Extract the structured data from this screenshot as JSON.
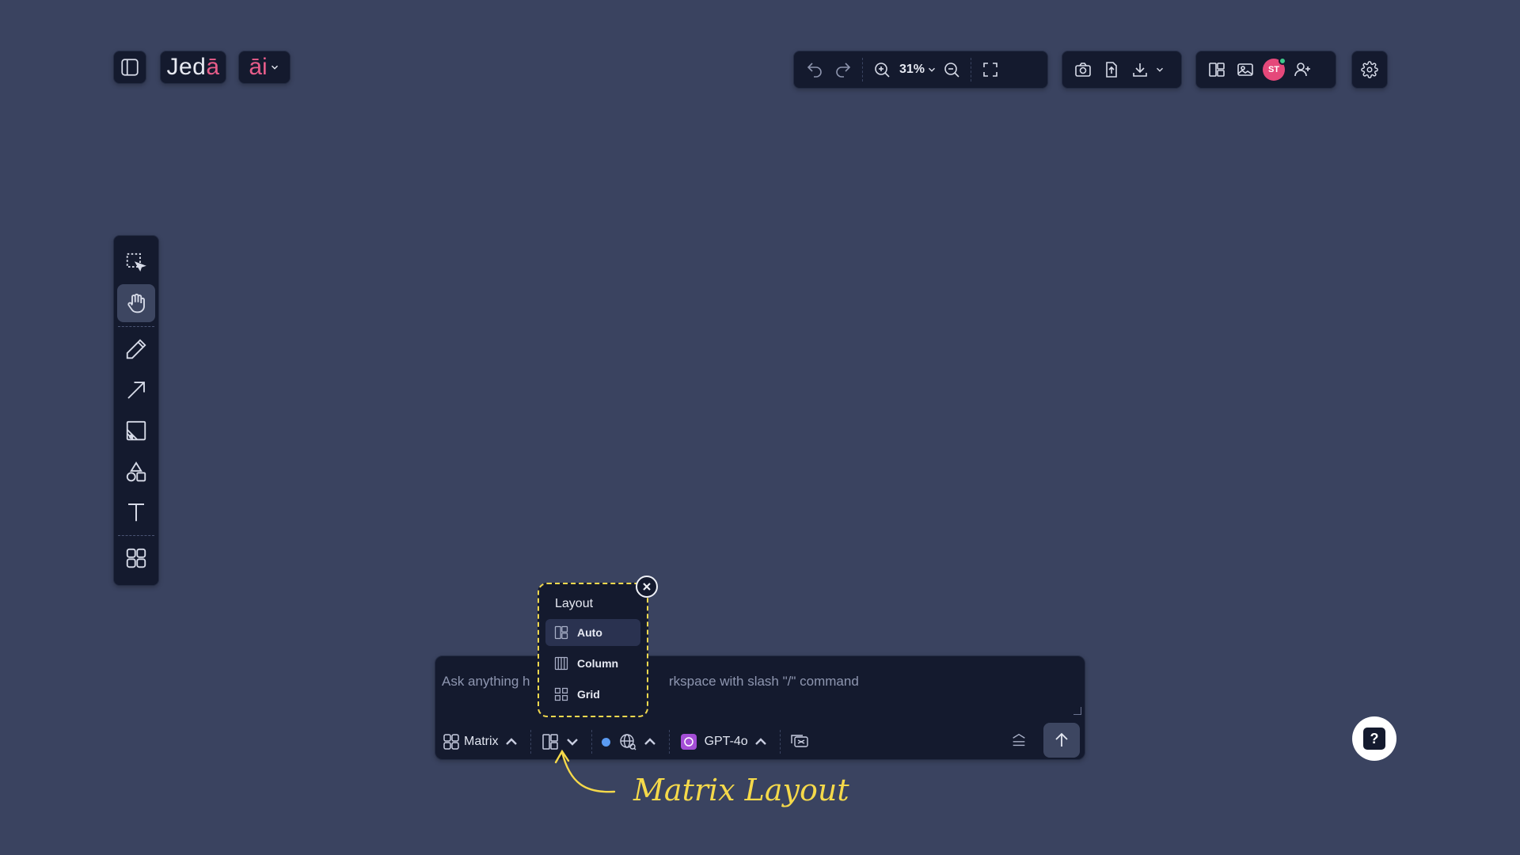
{
  "header": {
    "logo_text_main": "Jed",
    "logo_text_accent": "ā",
    "ai_label": "āi"
  },
  "toolbar": {
    "zoom_value": "31%",
    "avatar_initials": "ST"
  },
  "chat": {
    "placeholder": "Ask anything h... workspace with slash \"/\" command",
    "placeholder_left": "Ask anything h",
    "placeholder_right": "rkspace with slash \"/\" command",
    "mode_label": "Matrix",
    "model_label": "GPT-4o"
  },
  "layout_menu": {
    "title": "Layout",
    "options": [
      "Auto",
      "Column",
      "Grid"
    ],
    "selected": "Auto"
  },
  "annotation": {
    "text": "Matrix Layout"
  },
  "colors": {
    "canvas": "#3a4360",
    "panel": "#141a2e",
    "accent_pink": "#e85d8a",
    "highlight_yellow": "#f2d94e",
    "online_green": "#3ec98b",
    "status_blue": "#5b9bf2"
  }
}
